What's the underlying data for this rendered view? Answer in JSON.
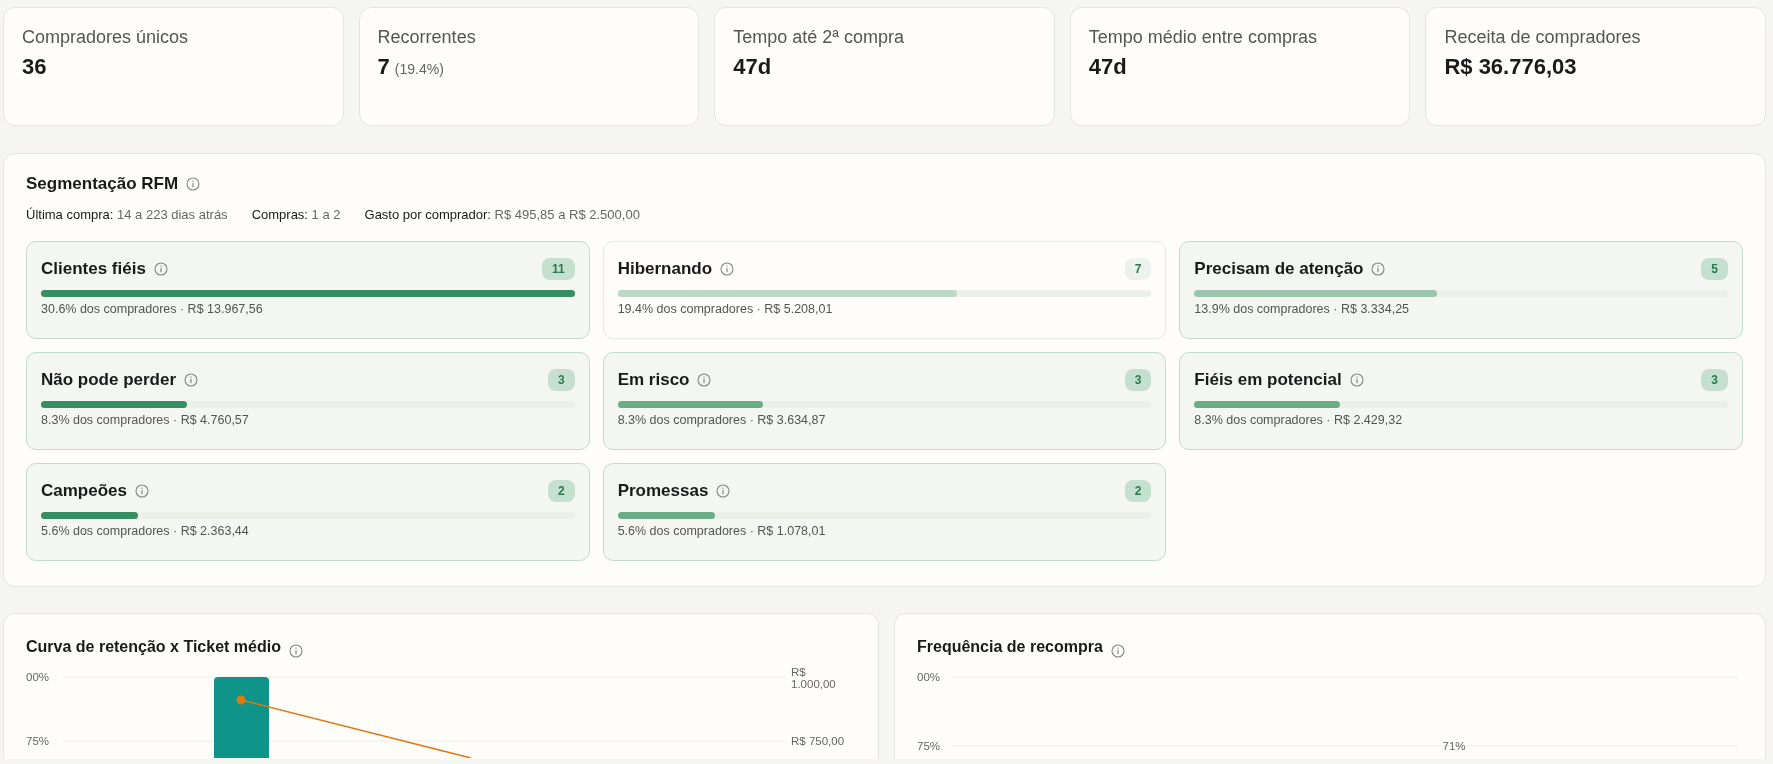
{
  "kpis": [
    {
      "label": "Compradores únicos",
      "value": "36"
    },
    {
      "label": "Recorrentes",
      "value": "7",
      "note": "(19.4%)"
    },
    {
      "label": "Tempo até 2ª compra",
      "value": "47d"
    },
    {
      "label": "Tempo médio entre compras",
      "value": "47d"
    },
    {
      "label": "Receita de compradores",
      "value": "R$ 36.776,03"
    }
  ],
  "rfm": {
    "title": "Segmentação RFM",
    "filters": [
      {
        "label": "Última compra:",
        "value": "14 a 223 dias atrás"
      },
      {
        "label": "Compras:",
        "value": "1 a 2"
      },
      {
        "label": "Gasto por comprador:",
        "value": "R$ 495,85 a R$ 2.500,00"
      }
    ],
    "segments": [
      {
        "name": "Clientes fiéis",
        "count": "11",
        "level": 1,
        "color": "#358f62",
        "muted": false,
        "caption": "30.6% dos compradores · R$ 13.967,56"
      },
      {
        "name": "Hibernando",
        "count": "7",
        "level": 0.636,
        "color": "#bcd8c6",
        "muted": true,
        "caption": "19.4% dos compradores · R$ 5.208,01"
      },
      {
        "name": "Precisam de atenção",
        "count": "5",
        "level": 0.455,
        "color": "#9bc7ac",
        "muted": false,
        "caption": "13.9% dos compradores · R$ 3.334,25"
      },
      {
        "name": "Não pode perder",
        "count": "3",
        "level": 0.273,
        "color": "#358f62",
        "muted": false,
        "caption": "8.3% dos compradores · R$ 4.760,57"
      },
      {
        "name": "Em risco",
        "count": "3",
        "level": 0.273,
        "color": "#6aae88",
        "muted": false,
        "caption": "8.3% dos compradores · R$ 3.634,87"
      },
      {
        "name": "Fiéis em potencial",
        "count": "3",
        "level": 0.273,
        "color": "#6aae88",
        "muted": false,
        "caption": "8.3% dos compradores · R$ 2.429,32"
      },
      {
        "name": "Campeões",
        "count": "2",
        "level": 0.182,
        "color": "#358f62",
        "muted": false,
        "caption": "5.6% dos compradores · R$ 2.363,44"
      },
      {
        "name": "Promessas",
        "count": "2",
        "level": 0.182,
        "color": "#6aae88",
        "muted": false,
        "caption": "5.6% dos compradores · R$ 1.078,01"
      }
    ]
  },
  "charts": [
    {
      "kind": "combo",
      "title": "Curva de retenção x Ticket médio",
      "y_labels": [
        "00%",
        "75%"
      ],
      "y2_labels": [
        "R$ 1.000,00",
        "R$ 750,00"
      ]
    },
    {
      "kind": "bars",
      "title": "Frequência de recompra",
      "y_labels": [
        "00%",
        "75%"
      ],
      "bar_labels": [
        "71%"
      ]
    }
  ]
}
